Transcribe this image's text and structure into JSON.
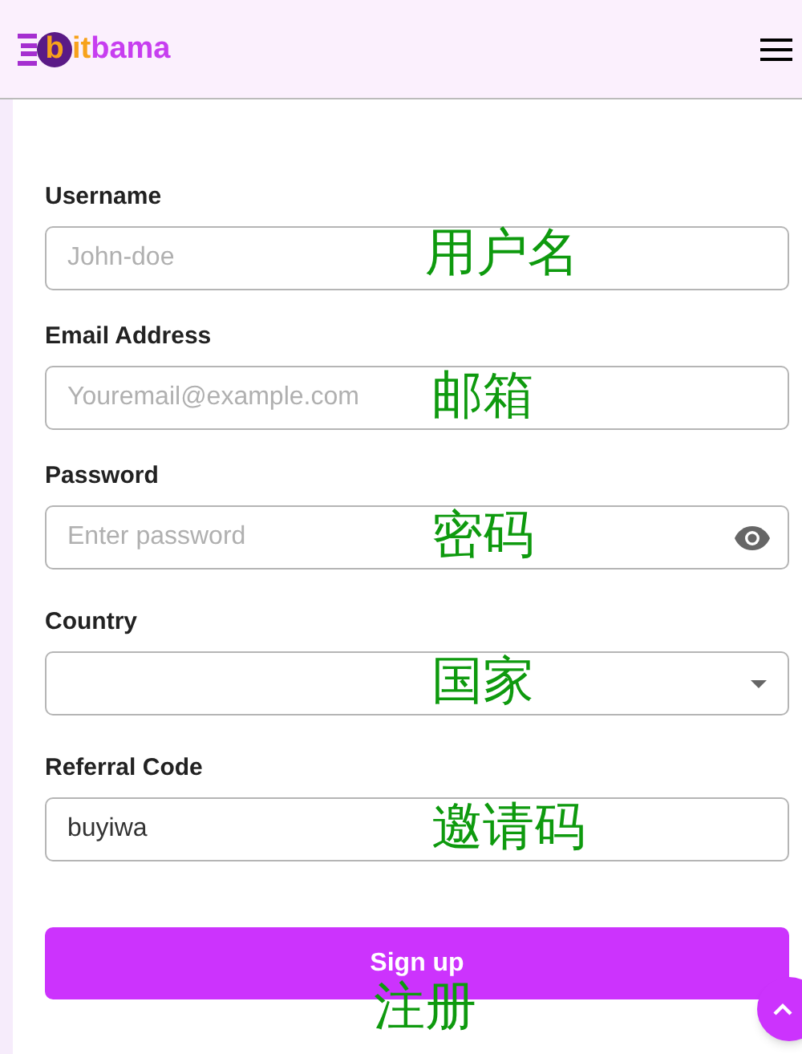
{
  "header": {
    "logo": {
      "letter": "b",
      "accent": "it",
      "rest": "bama"
    }
  },
  "fields": [
    {
      "kind": "text",
      "label": "Username",
      "placeholder": "John-doe",
      "annotation": "用户名"
    },
    {
      "kind": "text",
      "label": "Email Address",
      "placeholder": "Youremail@example.com",
      "annotation": "邮箱"
    },
    {
      "kind": "password",
      "label": "Password",
      "placeholder": "Enter password",
      "annotation": "密码"
    },
    {
      "kind": "select",
      "label": "Country",
      "annotation": "国家"
    },
    {
      "kind": "text",
      "label": "Referral Code",
      "value": "buyiwa",
      "annotation": "邀请码"
    }
  ],
  "submit": {
    "label": "Sign up",
    "annotation": "注册"
  }
}
